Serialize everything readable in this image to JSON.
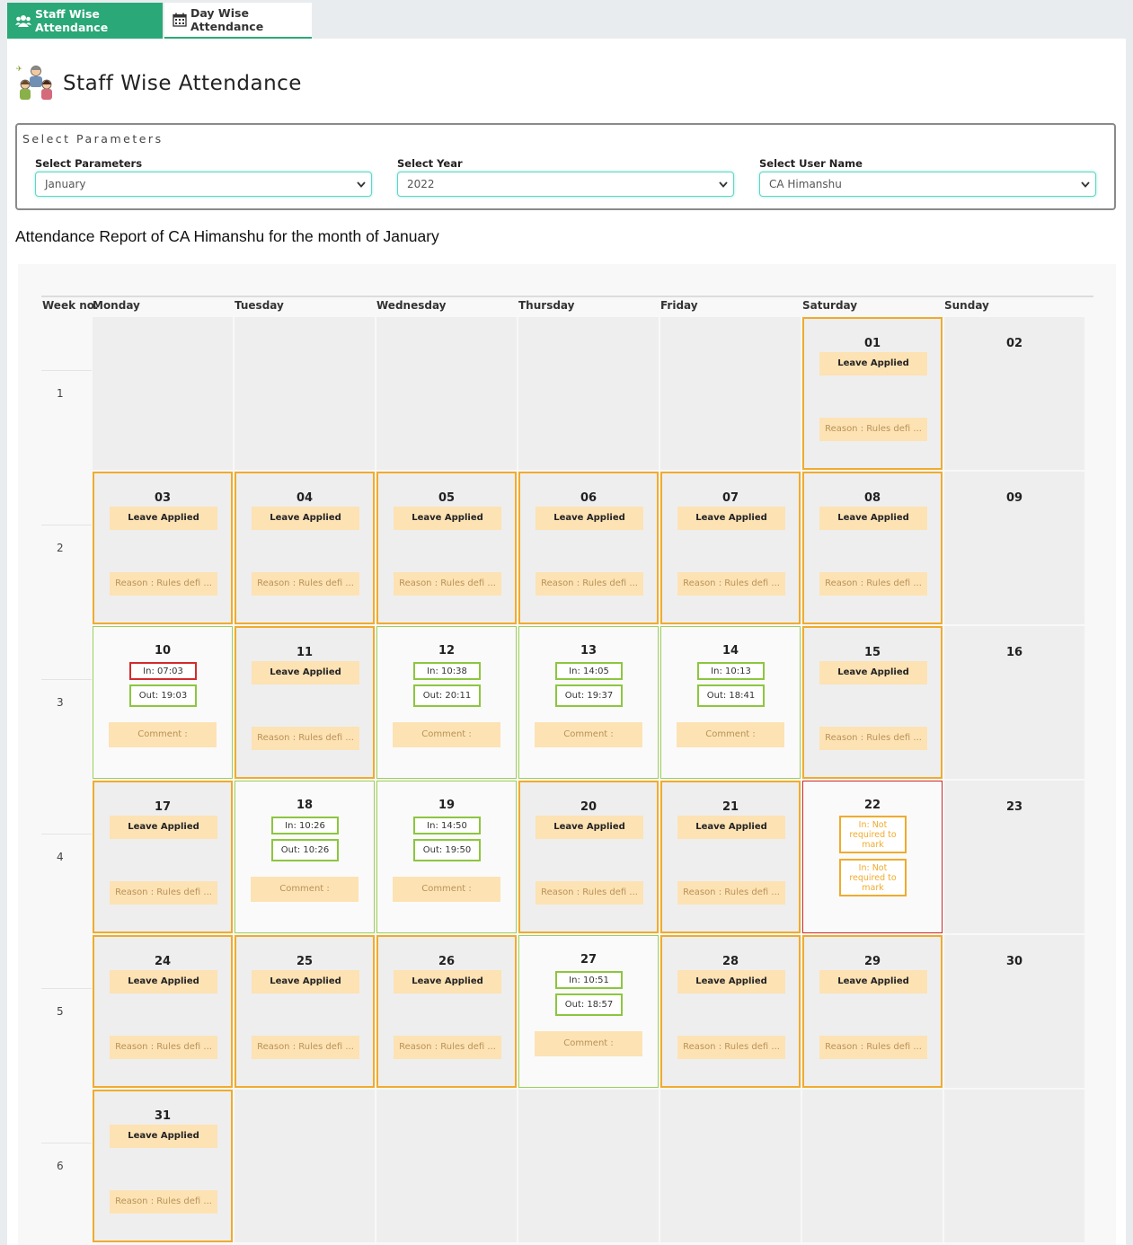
{
  "tabs": [
    {
      "label": "Staff Wise Attendance",
      "active": true,
      "icon": "users-icon"
    },
    {
      "label": "Day Wise Attendance",
      "active": false,
      "icon": "calendar-icon"
    }
  ],
  "page_title": "Staff Wise Attendance",
  "params": {
    "legend": "Select Parameters",
    "month": {
      "label": "Select Parameters",
      "value": "January"
    },
    "year": {
      "label": "Select Year",
      "value": "2022"
    },
    "user": {
      "label": "Select User Name",
      "value": "CA Himanshu"
    }
  },
  "report_title": "Attendance Report of CA Himanshu for the month of January",
  "calendar": {
    "week_header": "Week no.",
    "days_of_week": [
      "Monday",
      "Tuesday",
      "Wednesday",
      "Thursday",
      "Friday",
      "Saturday",
      "Sunday"
    ],
    "weeks": [
      "1",
      "2",
      "3",
      "4",
      "5",
      "6"
    ],
    "texts": {
      "leave": "Leave Applied",
      "reason": "Reason : Rules defi ...",
      "comment": "Comment :",
      "not_required_in": "In: Not required to mark",
      "not_required_out": "In: Not required to mark"
    },
    "cells": [
      {
        "day": "01",
        "week": 0,
        "dow": 5,
        "status": "leave"
      },
      {
        "day": "02",
        "week": 0,
        "dow": 6,
        "status": "off"
      },
      {
        "day": "03",
        "week": 1,
        "dow": 0,
        "status": "leave"
      },
      {
        "day": "04",
        "week": 1,
        "dow": 1,
        "status": "leave"
      },
      {
        "day": "05",
        "week": 1,
        "dow": 2,
        "status": "leave"
      },
      {
        "day": "06",
        "week": 1,
        "dow": 3,
        "status": "leave"
      },
      {
        "day": "07",
        "week": 1,
        "dow": 4,
        "status": "leave"
      },
      {
        "day": "08",
        "week": 1,
        "dow": 5,
        "status": "leave"
      },
      {
        "day": "09",
        "week": 1,
        "dow": 6,
        "status": "off"
      },
      {
        "day": "10",
        "week": 2,
        "dow": 0,
        "status": "present",
        "in": "In: 07:03",
        "out": "Out: 19:03",
        "late": true
      },
      {
        "day": "11",
        "week": 2,
        "dow": 1,
        "status": "leave"
      },
      {
        "day": "12",
        "week": 2,
        "dow": 2,
        "status": "present",
        "in": "In: 10:38",
        "out": "Out: 20:11"
      },
      {
        "day": "13",
        "week": 2,
        "dow": 3,
        "status": "present",
        "in": "In: 14:05",
        "out": "Out: 19:37"
      },
      {
        "day": "14",
        "week": 2,
        "dow": 4,
        "status": "present",
        "in": "In: 10:13",
        "out": "Out: 18:41"
      },
      {
        "day": "15",
        "week": 2,
        "dow": 5,
        "status": "leave"
      },
      {
        "day": "16",
        "week": 2,
        "dow": 6,
        "status": "off"
      },
      {
        "day": "17",
        "week": 3,
        "dow": 0,
        "status": "leave"
      },
      {
        "day": "18",
        "week": 3,
        "dow": 1,
        "status": "present",
        "in": "In: 10:26",
        "out": "Out: 10:26"
      },
      {
        "day": "19",
        "week": 3,
        "dow": 2,
        "status": "present",
        "in": "In: 14:50",
        "out": "Out: 19:50"
      },
      {
        "day": "20",
        "week": 3,
        "dow": 3,
        "status": "leave"
      },
      {
        "day": "21",
        "week": 3,
        "dow": 4,
        "status": "leave"
      },
      {
        "day": "22",
        "week": 3,
        "dow": 5,
        "status": "absent"
      },
      {
        "day": "23",
        "week": 3,
        "dow": 6,
        "status": "off"
      },
      {
        "day": "24",
        "week": 4,
        "dow": 0,
        "status": "leave"
      },
      {
        "day": "25",
        "week": 4,
        "dow": 1,
        "status": "leave"
      },
      {
        "day": "26",
        "week": 4,
        "dow": 2,
        "status": "leave"
      },
      {
        "day": "27",
        "week": 4,
        "dow": 3,
        "status": "present",
        "in": "In: 10:51",
        "out": "Out: 18:57"
      },
      {
        "day": "28",
        "week": 4,
        "dow": 4,
        "status": "leave"
      },
      {
        "day": "29",
        "week": 4,
        "dow": 5,
        "status": "leave"
      },
      {
        "day": "30",
        "week": 4,
        "dow": 6,
        "status": "off"
      },
      {
        "day": "31",
        "week": 5,
        "dow": 0,
        "status": "leave"
      },
      {
        "day": "",
        "week": 0,
        "dow": 0,
        "status": "empty"
      },
      {
        "day": "",
        "week": 0,
        "dow": 1,
        "status": "empty"
      },
      {
        "day": "",
        "week": 0,
        "dow": 2,
        "status": "empty"
      },
      {
        "day": "",
        "week": 0,
        "dow": 3,
        "status": "empty"
      },
      {
        "day": "",
        "week": 0,
        "dow": 4,
        "status": "empty"
      },
      {
        "day": "",
        "week": 5,
        "dow": 1,
        "status": "empty"
      },
      {
        "day": "",
        "week": 5,
        "dow": 2,
        "status": "empty"
      },
      {
        "day": "",
        "week": 5,
        "dow": 3,
        "status": "empty"
      },
      {
        "day": "",
        "week": 5,
        "dow": 4,
        "status": "empty"
      },
      {
        "day": "",
        "week": 5,
        "dow": 5,
        "status": "empty"
      },
      {
        "day": "",
        "week": 5,
        "dow": 6,
        "status": "empty"
      }
    ]
  },
  "colors": {
    "accent": "#2aa877",
    "leave_border": "#f0ab2d",
    "present_border": "#8cc63f",
    "late_border": "#d42b2b"
  }
}
